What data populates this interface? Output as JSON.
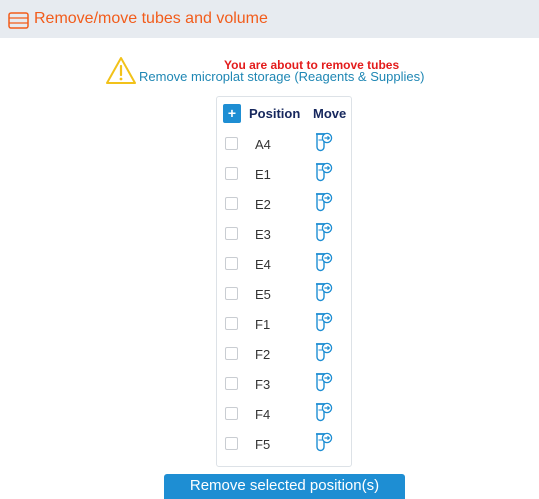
{
  "header": {
    "title": "Remove/move tubes and volume",
    "icon": "drawer-icon",
    "accent_color": "#f25c1b"
  },
  "warning": {
    "icon": "warning-triangle-icon",
    "message": "You are about to remove tubes",
    "detail": "Remove microplat storage (Reagents & Supplies)"
  },
  "table": {
    "add_label": "+",
    "columns": {
      "position": "Position",
      "move": "Move"
    },
    "rows": [
      {
        "position": "A4",
        "checked": false
      },
      {
        "position": "E1",
        "checked": false
      },
      {
        "position": "E2",
        "checked": false
      },
      {
        "position": "E3",
        "checked": false
      },
      {
        "position": "E4",
        "checked": false
      },
      {
        "position": "E5",
        "checked": false
      },
      {
        "position": "F1",
        "checked": false
      },
      {
        "position": "F2",
        "checked": false
      },
      {
        "position": "F3",
        "checked": false
      },
      {
        "position": "F4",
        "checked": false
      },
      {
        "position": "F5",
        "checked": false
      }
    ],
    "move_icon": "tube-move-icon"
  },
  "actions": {
    "remove_label": "Remove selected position(s)",
    "button_color": "#1e8ed3"
  }
}
